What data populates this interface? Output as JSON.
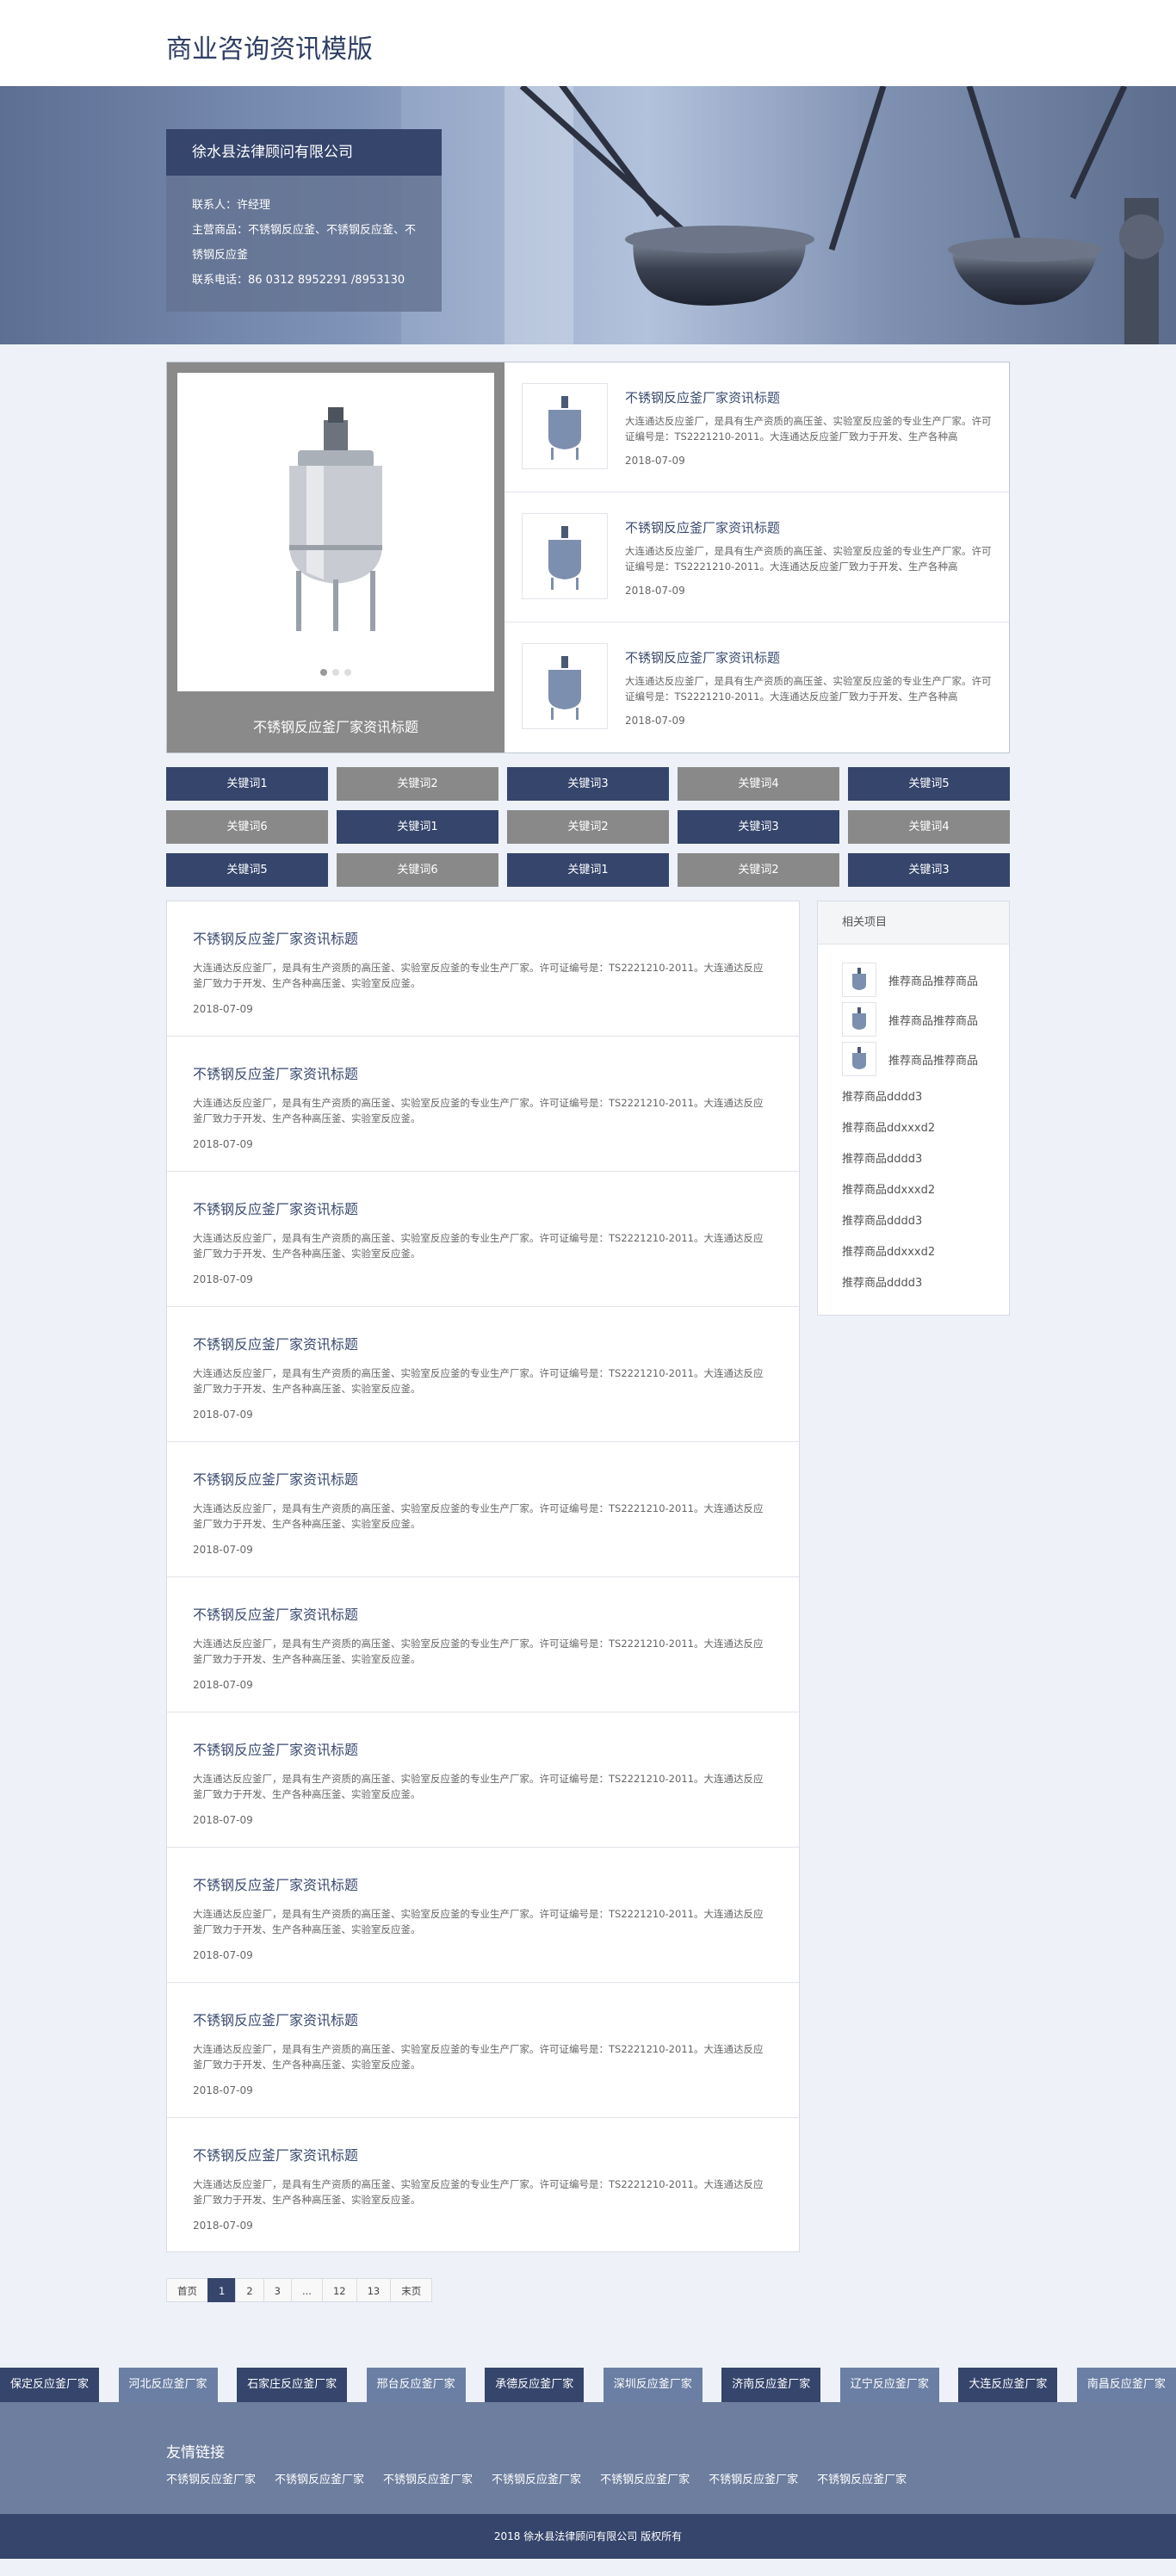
{
  "header": {
    "title": "商业咨询资讯模版"
  },
  "company": {
    "name": "徐水县法律顾问有限公司",
    "contact": "联系人：许经理",
    "products": "主营商品：不锈钢反应釜、不锈钢反应釜、不锈钢反应釜",
    "phone": "联系电话：86 0312 8952291 /8953130"
  },
  "slider": {
    "caption": "不锈钢反应釜厂家资讯标题"
  },
  "top_news": [
    {
      "title": "不锈钢反应釜厂家资讯标题",
      "desc": "大连通达反应釜厂，是具有生产资质的高压釜、实验室反应釜的专业生产厂家。许可证编号是：TS2221210-2011。大连通达反应釜厂致力于开发、生产各种高",
      "date": "2018-07-09"
    },
    {
      "title": "不锈钢反应釜厂家资讯标题",
      "desc": "大连通达反应釜厂，是具有生产资质的高压釜、实验室反应釜的专业生产厂家。许可证编号是：TS2221210-2011。大连通达反应釜厂致力于开发、生产各种高",
      "date": "2018-07-09"
    },
    {
      "title": "不锈钢反应釜厂家资讯标题",
      "desc": "大连通达反应釜厂，是具有生产资质的高压釜、实验室反应釜的专业生产厂家。许可证编号是：TS2221210-2011。大连通达反应釜厂致力于开发、生产各种高",
      "date": "2018-07-09"
    }
  ],
  "keywords": [
    {
      "label": "关键词1",
      "style": "dark"
    },
    {
      "label": "关键词2",
      "style": "gray"
    },
    {
      "label": "关键词3",
      "style": "dark"
    },
    {
      "label": "关键词4",
      "style": "gray"
    },
    {
      "label": "关键词5",
      "style": "dark"
    },
    {
      "label": "关键词6",
      "style": "gray"
    },
    {
      "label": "关键词1",
      "style": "dark"
    },
    {
      "label": "关键词2",
      "style": "gray"
    },
    {
      "label": "关键词3",
      "style": "dark"
    },
    {
      "label": "关键词4",
      "style": "gray"
    },
    {
      "label": "关键词5",
      "style": "dark"
    },
    {
      "label": "关键词6",
      "style": "gray"
    },
    {
      "label": "关键词1",
      "style": "dark"
    },
    {
      "label": "关键词2",
      "style": "gray"
    },
    {
      "label": "关键词3",
      "style": "dark"
    }
  ],
  "articles": [
    {
      "title": "不锈钢反应釜厂家资讯标题",
      "desc": "大连通达反应釜厂，是具有生产资质的高压釜、实验室反应釜的专业生产厂家。许可证编号是：TS2221210-2011。大连通达反应釜厂致力于开发、生产各种高压釜、实验室反应釜。",
      "date": "2018-07-09"
    },
    {
      "title": "不锈钢反应釜厂家资讯标题",
      "desc": "大连通达反应釜厂，是具有生产资质的高压釜、实验室反应釜的专业生产厂家。许可证编号是：TS2221210-2011。大连通达反应釜厂致力于开发、生产各种高压釜、实验室反应釜。",
      "date": "2018-07-09"
    },
    {
      "title": "不锈钢反应釜厂家资讯标题",
      "desc": "大连通达反应釜厂，是具有生产资质的高压釜、实验室反应釜的专业生产厂家。许可证编号是：TS2221210-2011。大连通达反应釜厂致力于开发、生产各种高压釜、实验室反应釜。",
      "date": "2018-07-09"
    },
    {
      "title": "不锈钢反应釜厂家资讯标题",
      "desc": "大连通达反应釜厂，是具有生产资质的高压釜、实验室反应釜的专业生产厂家。许可证编号是：TS2221210-2011。大连通达反应釜厂致力于开发、生产各种高压釜、实验室反应釜。",
      "date": "2018-07-09"
    },
    {
      "title": "不锈钢反应釜厂家资讯标题",
      "desc": "大连通达反应釜厂，是具有生产资质的高压釜、实验室反应釜的专业生产厂家。许可证编号是：TS2221210-2011。大连通达反应釜厂致力于开发、生产各种高压釜、实验室反应釜。",
      "date": "2018-07-09"
    },
    {
      "title": "不锈钢反应釜厂家资讯标题",
      "desc": "大连通达反应釜厂，是具有生产资质的高压釜、实验室反应釜的专业生产厂家。许可证编号是：TS2221210-2011。大连通达反应釜厂致力于开发、生产各种高压釜、实验室反应釜。",
      "date": "2018-07-09"
    },
    {
      "title": "不锈钢反应釜厂家资讯标题",
      "desc": "大连通达反应釜厂，是具有生产资质的高压釜、实验室反应釜的专业生产厂家。许可证编号是：TS2221210-2011。大连通达反应釜厂致力于开发、生产各种高压釜、实验室反应釜。",
      "date": "2018-07-09"
    },
    {
      "title": "不锈钢反应釜厂家资讯标题",
      "desc": "大连通达反应釜厂，是具有生产资质的高压釜、实验室反应釜的专业生产厂家。许可证编号是：TS2221210-2011。大连通达反应釜厂致力于开发、生产各种高压釜、实验室反应釜。",
      "date": "2018-07-09"
    },
    {
      "title": "不锈钢反应釜厂家资讯标题",
      "desc": "大连通达反应釜厂，是具有生产资质的高压釜、实验室反应釜的专业生产厂家。许可证编号是：TS2221210-2011。大连通达反应釜厂致力于开发、生产各种高压釜、实验室反应釜。",
      "date": "2018-07-09"
    },
    {
      "title": "不锈钢反应釜厂家资讯标题",
      "desc": "大连通达反应釜厂，是具有生产资质的高压釜、实验室反应釜的专业生产厂家。许可证编号是：TS2221210-2011。大连通达反应釜厂致力于开发、生产各种高压釜、实验室反应釜。",
      "date": "2018-07-09"
    }
  ],
  "sidebar": {
    "title": "相关项目",
    "rec_items": [
      "推荐商品推荐商品",
      "推荐商品推荐商品",
      "推荐商品推荐商品"
    ],
    "plain_items": [
      "推荐商品dddd3",
      "推荐商品ddxxxd2",
      "推荐商品dddd3",
      "推荐商品ddxxxd2",
      "推荐商品dddd3",
      "推荐商品ddxxxd2",
      "推荐商品dddd3"
    ]
  },
  "pager": {
    "first": "首页",
    "p1": "1",
    "p2": "2",
    "p3": "3",
    "ellipsis": "...",
    "p12": "12",
    "p13": "13",
    "last": "末页"
  },
  "cities": [
    {
      "label": "保定反应釜厂家",
      "style": "dark"
    },
    {
      "label": "河北反应釜厂家",
      "style": "gray"
    },
    {
      "label": "石家庄反应釜厂家",
      "style": "dark"
    },
    {
      "label": "邢台反应釜厂家",
      "style": "gray"
    },
    {
      "label": "承德反应釜厂家",
      "style": "dark"
    },
    {
      "label": "深圳反应釜厂家",
      "style": "gray"
    },
    {
      "label": "济南反应釜厂家",
      "style": "dark"
    },
    {
      "label": "辽宁反应釜厂家",
      "style": "gray"
    },
    {
      "label": "大连反应釜厂家",
      "style": "dark"
    },
    {
      "label": "南昌反应釜厂家",
      "style": "gray"
    }
  ],
  "friend_links": {
    "title": "友情链接",
    "items": [
      "不锈钢反应釜厂家",
      "不锈钢反应釜厂家",
      "不锈钢反应釜厂家",
      "不锈钢反应釜厂家",
      "不锈钢反应釜厂家",
      "不锈钢反应釜厂家",
      "不锈钢反应釜厂家"
    ]
  },
  "footer": {
    "copyright": "2018 徐水县法律顾问有限公司 版权所有"
  },
  "colors": {
    "primary": "#35456c",
    "gray": "#898989",
    "city_gray": "#6b7fa4",
    "links_bg": "#6d7e9f",
    "page_bg": "#eef2f8"
  }
}
